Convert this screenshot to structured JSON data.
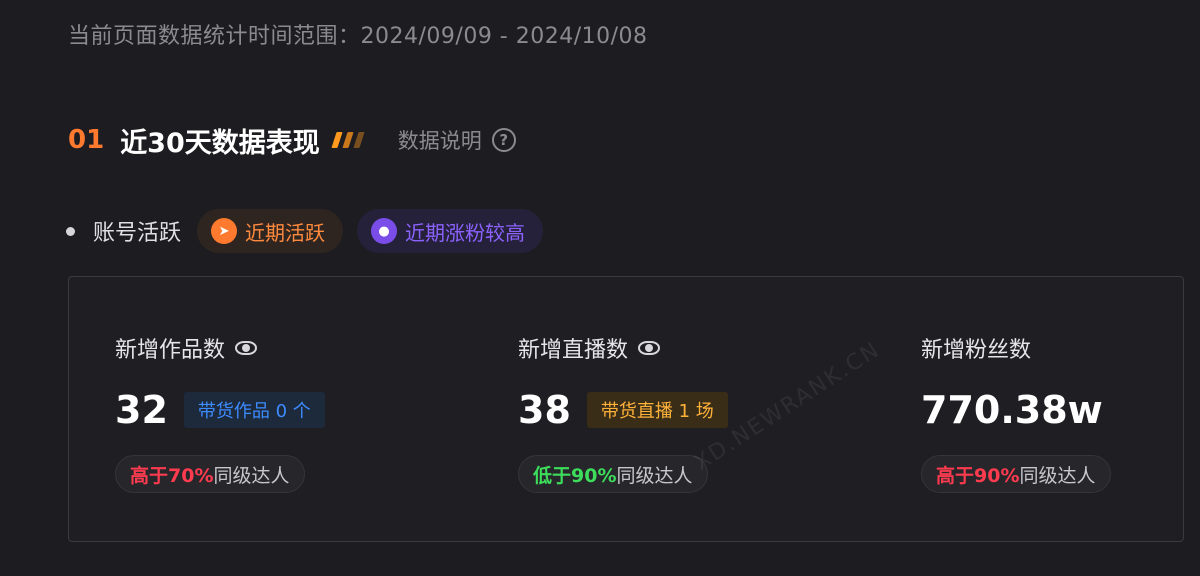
{
  "header": {
    "date_range_label": "当前页面数据统计时间范围：",
    "date_range_value": "2024/09/09 - 2024/10/08"
  },
  "section": {
    "number": "01",
    "title": "近30天数据表现",
    "explain_label": "数据说明",
    "help_icon": "?"
  },
  "activity": {
    "label": "账号活跃",
    "tags": [
      {
        "label": "近期活跃",
        "icon": "paper-plane-icon",
        "color": "#ff7a2e"
      },
      {
        "label": "近期涨粉较高",
        "icon": "user-icon",
        "color": "#7a4de8"
      }
    ]
  },
  "stats": [
    {
      "label": "新增作品数",
      "value": "32",
      "sub_tag": "带货作品 0 个",
      "compare_highlight": "高于70%",
      "compare_rest": "同级达人"
    },
    {
      "label": "新增直播数",
      "value": "38",
      "sub_tag": "带货直播 1 场",
      "compare_highlight": "低于90%",
      "compare_rest": "同级达人"
    },
    {
      "label": "新增粉丝数",
      "value": "770.38w",
      "compare_highlight": "高于90%",
      "compare_rest": "同级达人"
    }
  ],
  "colors": {
    "accent_orange": "#ff7a2e",
    "accent_purple": "#7a4de8",
    "higher_red": "#ff3b4f",
    "lower_green": "#3ddc5b",
    "tag_blue": "#3d8bff",
    "tag_gold": "#ffb23a"
  },
  "watermark": "XD.NEWRANK.CN"
}
